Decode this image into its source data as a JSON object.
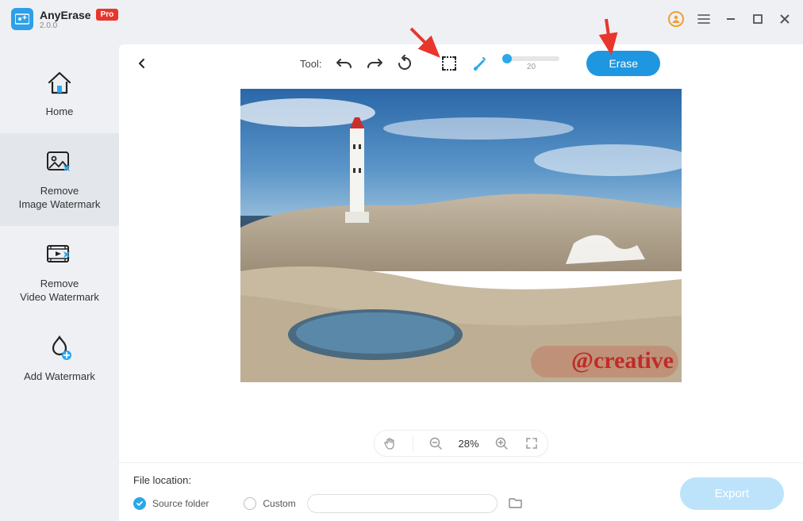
{
  "app": {
    "name": "AnyErase",
    "version": "2.0.0",
    "badge": "Pro"
  },
  "sidebar": {
    "items": [
      {
        "label": "Home"
      },
      {
        "label": "Remove\nImage Watermark"
      },
      {
        "label": "Remove\nVideo Watermark"
      },
      {
        "label": "Add Watermark"
      }
    ]
  },
  "toolbar": {
    "label": "Tool:",
    "brush_size": "20",
    "erase": "Erase"
  },
  "zoom": {
    "percent": "28%"
  },
  "footer": {
    "title": "File location:",
    "source": "Source folder",
    "custom": "Custom",
    "export": "Export"
  },
  "image": {
    "watermark": "@creative"
  }
}
